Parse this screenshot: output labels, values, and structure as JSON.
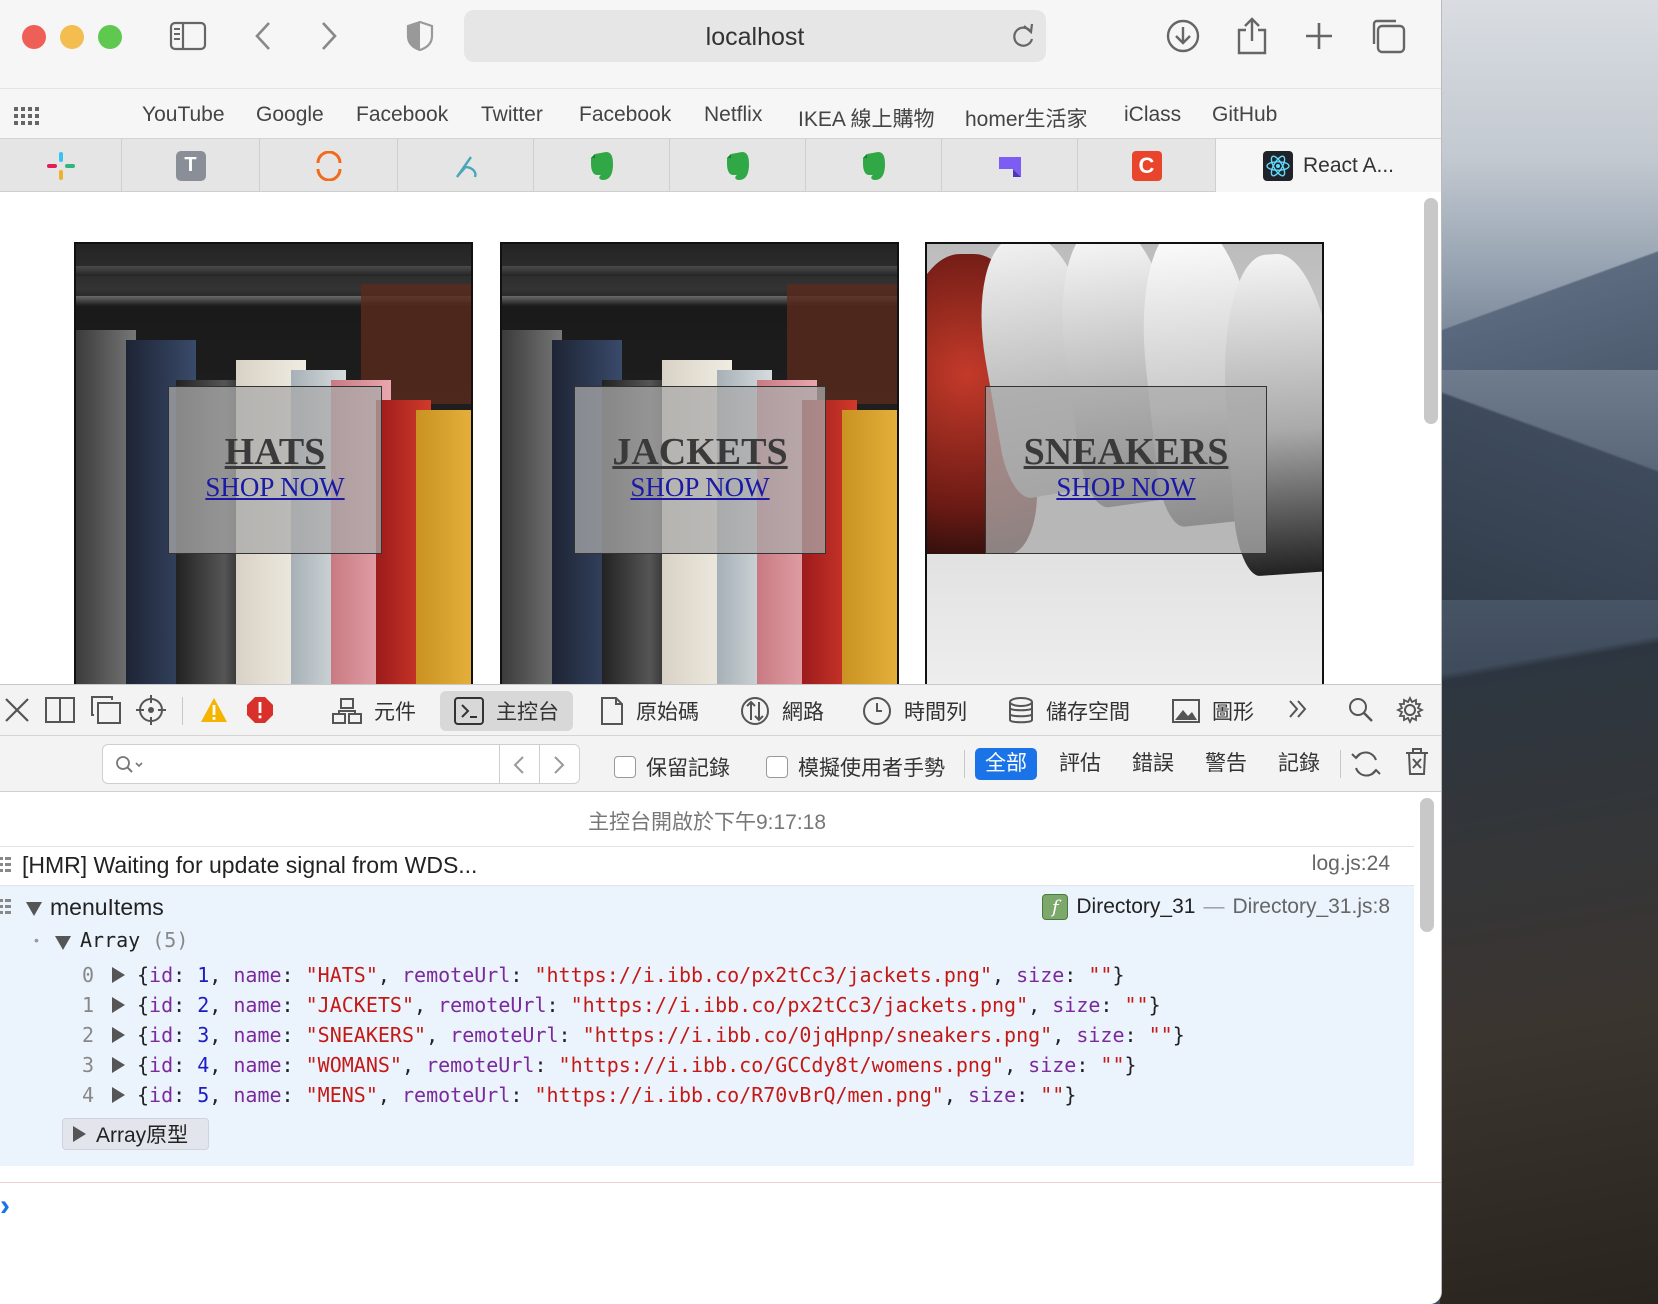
{
  "browser": {
    "url": "localhost",
    "favorites": [
      "YouTube",
      "Google",
      "Facebook",
      "Twitter",
      "Facebook",
      "Netflix",
      "IKEA 線上購物",
      "homer生活家",
      "iClass",
      "GitHub"
    ],
    "active_tab_title": "React A..."
  },
  "page": {
    "cards": [
      {
        "title": "HATS",
        "subtitle": "SHOP NOW"
      },
      {
        "title": "JACKETS",
        "subtitle": "SHOP NOW"
      },
      {
        "title": "SNEAKERS",
        "subtitle": "SHOP NOW"
      }
    ]
  },
  "devtools": {
    "tabs": [
      "元件",
      "主控台",
      "原始碼",
      "網路",
      "時間列",
      "儲存空間",
      "圖形"
    ],
    "selected_tab": "主控台",
    "checkboxes": [
      "保留記錄",
      "模擬使用者手勢"
    ],
    "levels": [
      "全部",
      "評估",
      "錯誤",
      "警告",
      "記錄"
    ],
    "console": {
      "opened_at": "主控台開啟於下午9:17:18",
      "hmr_message": "[HMR] Waiting for update signal from WDS...",
      "hmr_source": "log.js:24",
      "group_label": "menuItems",
      "group_func": "Directory_31",
      "group_sep": "—",
      "group_source": "Directory_31.js:8",
      "array_label": "Array",
      "array_count": "(5)",
      "items": [
        {
          "index": "0",
          "id": "1",
          "name": "\"HATS\"",
          "url": "\"https://i.ibb.co/px2tCc3/jackets.png\"",
          "size": "\"\""
        },
        {
          "index": "1",
          "id": "2",
          "name": "\"JACKETS\"",
          "url": "\"https://i.ibb.co/px2tCc3/jackets.png\"",
          "size": "\"\""
        },
        {
          "index": "2",
          "id": "3",
          "name": "\"SNEAKERS\"",
          "url": "\"https://i.ibb.co/0jqHpnp/sneakers.png\"",
          "size": "\"\""
        },
        {
          "index": "3",
          "id": "4",
          "name": "\"WOMANS\"",
          "url": "\"https://i.ibb.co/GCCdy8t/womens.png\"",
          "size": "\"\""
        },
        {
          "index": "4",
          "id": "5",
          "name": "\"MENS\"",
          "url": "\"https://i.ibb.co/R70vBrQ/men.png\"",
          "size": "\"\""
        }
      ],
      "keys": {
        "id": "id",
        "name": "name",
        "url": "remoteUrl",
        "size": "size"
      },
      "prototype_label": "Array原型",
      "prompt": "›"
    }
  },
  "colors": {
    "accent": "#1a74e8",
    "close": "#ee5f57",
    "minimize": "#f4bd4f",
    "zoom": "#5ec84f"
  }
}
